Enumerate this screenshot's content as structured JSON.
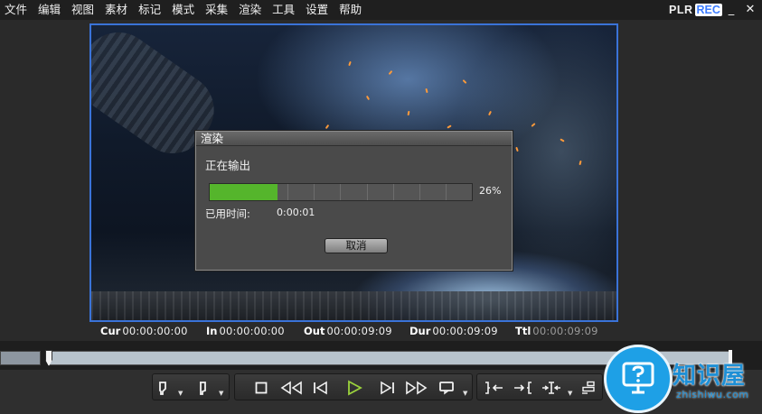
{
  "menu": {
    "items": [
      "文件",
      "编辑",
      "视图",
      "素材",
      "标记",
      "模式",
      "采集",
      "渲染",
      "工具",
      "设置",
      "帮助"
    ]
  },
  "brand": {
    "plr": "PLR",
    "rec": "REC"
  },
  "window_controls": {
    "minimize_icon": "_",
    "close_icon": "✕"
  },
  "dialog": {
    "title": "渲染",
    "status": "正在输出",
    "progress": 0.26,
    "percent_text": "26%",
    "elapsed_label": "已用时间:",
    "elapsed_value": "0:00:01",
    "cancel_label": "取消"
  },
  "timecodes": [
    {
      "label": "Cur",
      "value": "00:00:00:00"
    },
    {
      "label": "In",
      "value": "00:00:00:00"
    },
    {
      "label": "Out",
      "value": "00:00:09:09"
    },
    {
      "label": "Dur",
      "value": "00:00:09:09"
    },
    {
      "label": "Ttl",
      "value": "00:00:09:09"
    }
  ],
  "controls": {
    "icons": [
      "mark-in-icon",
      "mark-out-icon",
      "stop-icon",
      "rewind-icon",
      "step-back-icon",
      "play-icon",
      "step-forward-icon",
      "fast-forward-icon",
      "loop-icon",
      "goto-in-icon",
      "goto-out-icon",
      "split-icon",
      "insert-icon"
    ],
    "play_color": "#9bd23c"
  },
  "watermark": {
    "title": "知识屋",
    "subtitle": "zhishiwu.com"
  },
  "colors": {
    "progress_fill": "#55b52c",
    "preview_border": "#3a73d8",
    "watermark": "#1e8fd5"
  }
}
